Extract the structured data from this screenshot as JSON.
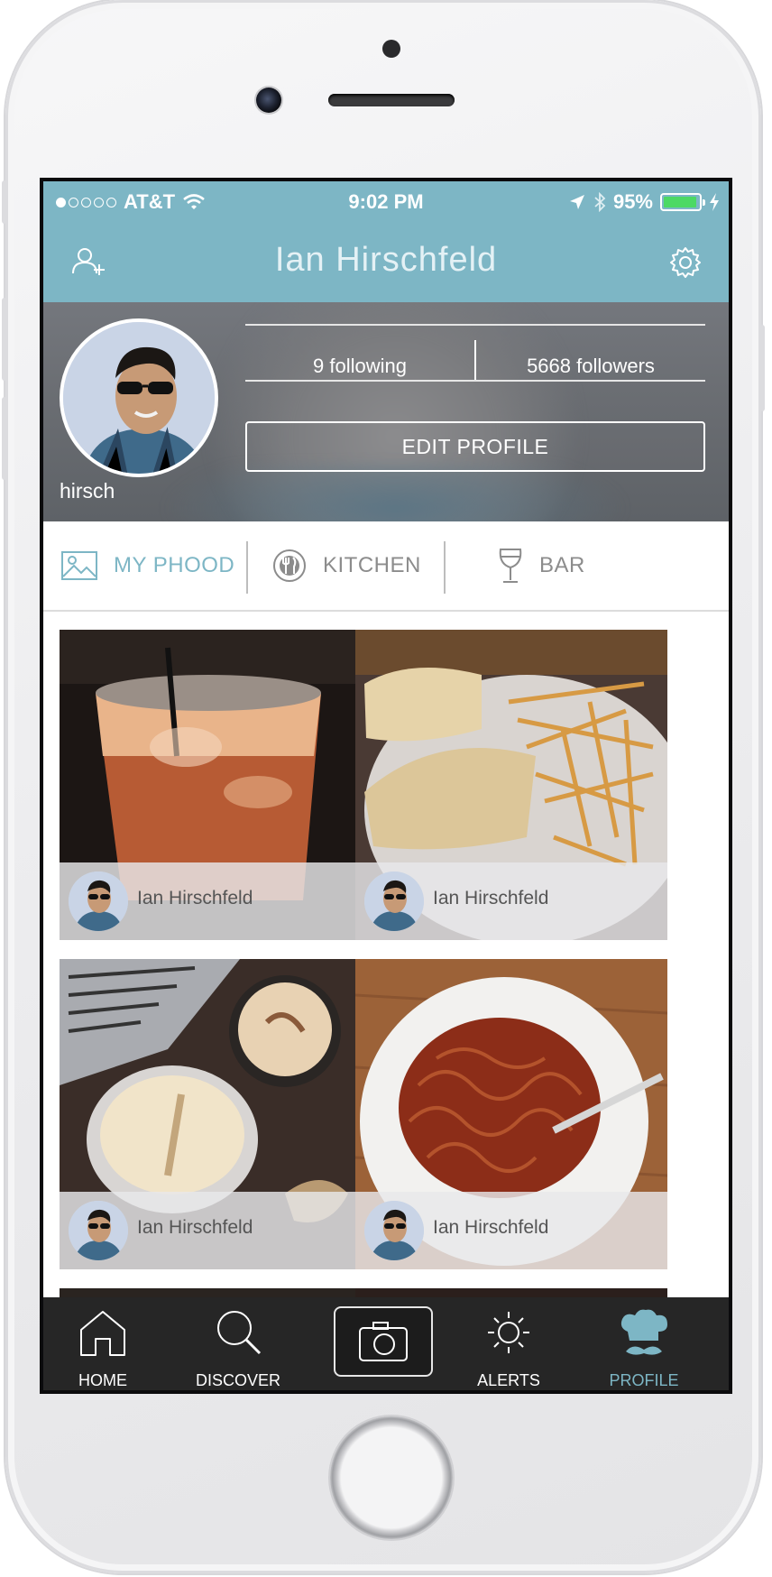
{
  "status_bar": {
    "carrier": "AT&T",
    "time": "9:02 PM",
    "battery_percent": "95%",
    "signal_bars_filled": 1,
    "signal_bars_total": 5,
    "battery_level": 0.95,
    "battery_color": "#4cd964"
  },
  "nav": {
    "title": "Ian Hirschfeld",
    "left_icon": "add-user-icon",
    "right_icon": "gear-icon",
    "bar_color": "#7db6c5"
  },
  "profile": {
    "username": "hirsch",
    "following": "9 following",
    "followers": "5668 followers",
    "edit_label": "EDIT PROFILE"
  },
  "tabs": [
    {
      "label": "MY PHOOD",
      "icon": "image-icon",
      "active": true
    },
    {
      "label": "KITCHEN",
      "icon": "plate-fork-knife-icon",
      "active": false
    },
    {
      "label": "BAR",
      "icon": "wine-glass-icon",
      "active": false
    }
  ],
  "posts": [
    {
      "poster": "Ian Hirschfeld",
      "photo": "iced-drink"
    },
    {
      "poster": "Ian Hirschfeld",
      "photo": "sandwich-and-fries"
    },
    {
      "poster": "Ian Hirschfeld",
      "photo": "lattes-and-laptop"
    },
    {
      "poster": "Ian Hirschfeld",
      "photo": "noodle-bowl"
    }
  ],
  "tabbar": [
    {
      "label": "HOME",
      "icon": "home-icon",
      "active": false
    },
    {
      "label": "DISCOVER",
      "icon": "search-icon",
      "active": false
    },
    {
      "label": "",
      "icon": "camera-icon",
      "active": false
    },
    {
      "label": "ALERTS",
      "icon": "sun-icon",
      "active": false
    },
    {
      "label": "PROFILE",
      "icon": "chef-hat-mustache-icon",
      "active": true
    }
  ],
  "accent_color": "#7db6c5"
}
